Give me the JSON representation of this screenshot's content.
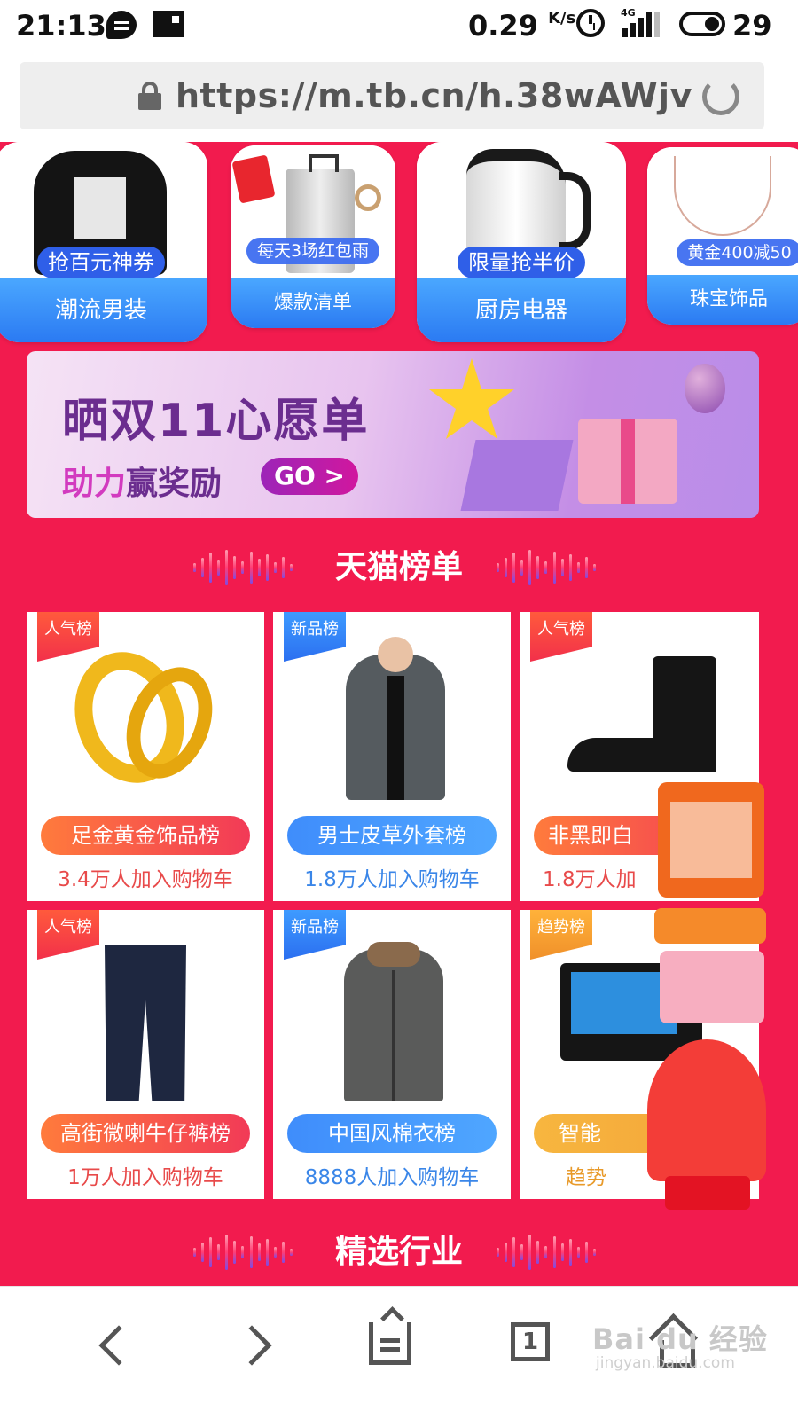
{
  "status_bar": {
    "time": "21:13",
    "net_speed": "0.29",
    "net_unit": "K/s",
    "signal_tag": "4G",
    "battery": "29"
  },
  "browser": {
    "url": "https://m.tb.cn/h.38wAWjv"
  },
  "categories": [
    {
      "label": "潮流男装",
      "promo": "抢百元神券"
    },
    {
      "label": "爆款清单",
      "promo": "每天3场红包雨"
    },
    {
      "label": "厨房电器",
      "promo": "限量抢半价"
    },
    {
      "label": "珠宝饰品",
      "promo": "黄金400减50"
    }
  ],
  "banner": {
    "title": "晒双11心愿单",
    "sub_highlight": "助力",
    "sub_rest": "赢奖励",
    "cta": "GO >"
  },
  "sections": {
    "ranking_title": "天猫榜单",
    "industry_title": "精选行业"
  },
  "products": [
    {
      "tag": "人气榜",
      "name": "足金黄金饰品榜",
      "count": "3.4万人加入购物车"
    },
    {
      "tag": "新品榜",
      "name": "男士皮草外套榜",
      "count": "1.8万人加入购物车"
    },
    {
      "tag": "人气榜",
      "name": "非黑即白",
      "count": "1.8万人加"
    },
    {
      "tag": "人气榜",
      "name": "高街微喇牛仔裤榜",
      "count": "1万人加入购物车"
    },
    {
      "tag": "新品榜",
      "name": "中国风棉衣榜",
      "count": "8888人加入购物车"
    },
    {
      "tag": "趋势榜",
      "name": "智能",
      "count": "趋势"
    }
  ],
  "bottom_nav": {
    "tab_count": "1",
    "watermark": "Bai du 经验",
    "watermark_url": "jingyan.baidu.com"
  }
}
